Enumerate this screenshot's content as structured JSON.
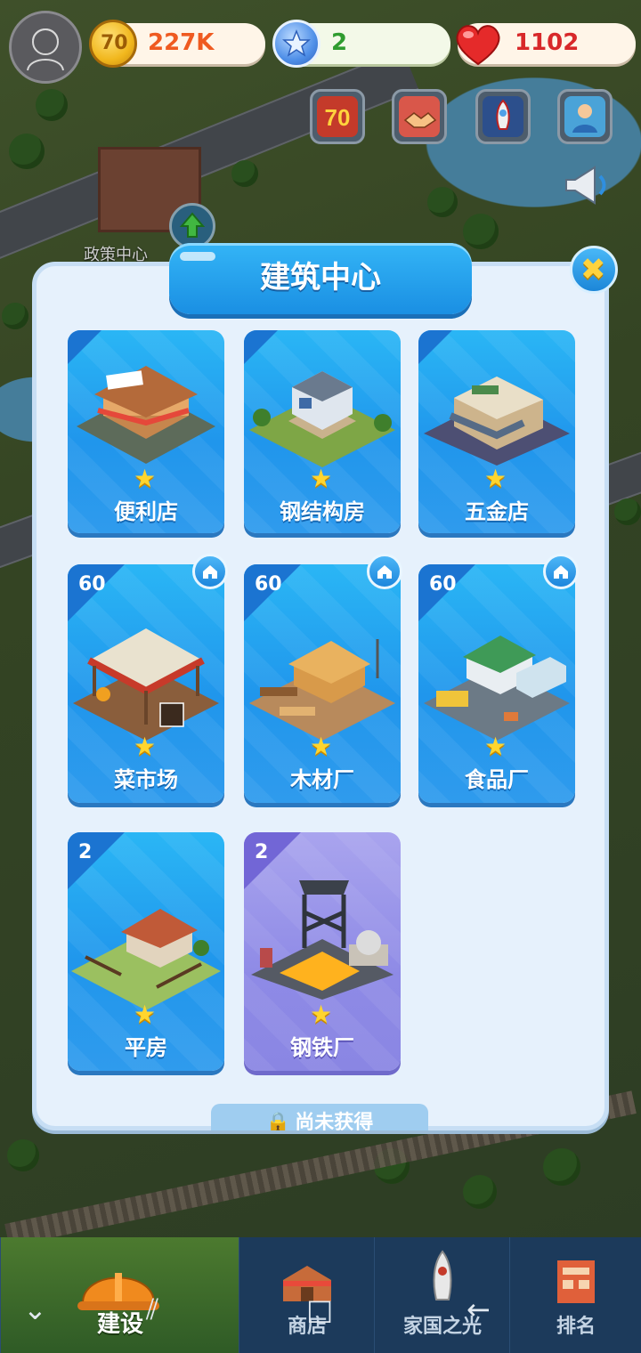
{
  "colors": {
    "accent": "#1a8fe3",
    "panel": "#e6f1fc",
    "coin": "#f1b71d",
    "gem": "#4f8fe8",
    "heart": "#e52a2a",
    "locked_card": "#8e8ae6"
  },
  "topbar": {
    "coins": "227K",
    "gems": "2",
    "hearts": "1102",
    "quick_buttons": [
      {
        "icon": "70-event-icon"
      },
      {
        "icon": "handshake-icon"
      },
      {
        "icon": "rocket-icon"
      },
      {
        "icon": "worker-icon"
      }
    ]
  },
  "map": {
    "building_label": "政策中心"
  },
  "dialog": {
    "title": "建筑中心",
    "close_icon": "close-icon",
    "cards": [
      {
        "name": "便利店",
        "level": "",
        "locked": false
      },
      {
        "name": "钢结构房",
        "level": "",
        "locked": false
      },
      {
        "name": "五金店",
        "level": "",
        "locked": false
      },
      {
        "name": "菜市场",
        "level": "60",
        "locked": false
      },
      {
        "name": "木材厂",
        "level": "60",
        "locked": false
      },
      {
        "name": "食品厂",
        "level": "60",
        "locked": false
      },
      {
        "name": "平房",
        "level": "2",
        "locked": false
      },
      {
        "name": "钢铁厂",
        "level": "2",
        "locked": true
      }
    ],
    "locked_label": "尚未获得"
  },
  "bottom_nav": {
    "tabs": [
      {
        "label": "建设",
        "active": true
      },
      {
        "label": "商店",
        "active": false
      },
      {
        "label": "家国之光",
        "active": false
      },
      {
        "label": "排名",
        "active": false
      }
    ]
  },
  "system_nav": {
    "collapse": "⌄",
    "recents": "⫽",
    "home": "□",
    "back": "←"
  }
}
